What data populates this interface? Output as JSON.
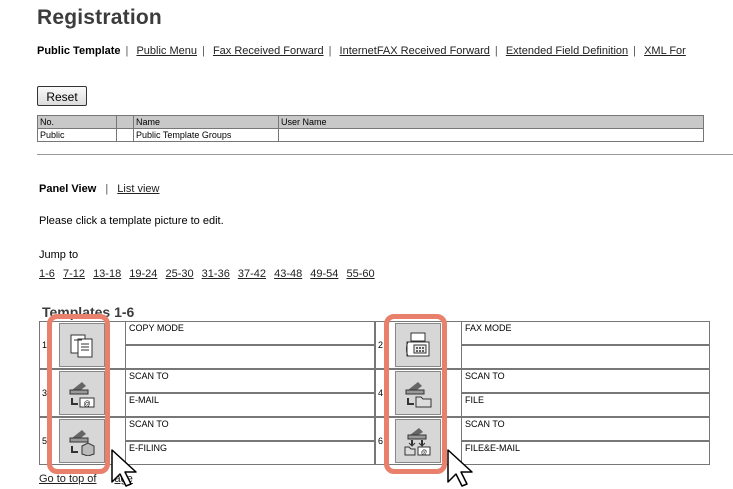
{
  "page_title": "Registration",
  "tabs": [
    {
      "label": "Public Template",
      "active": true
    },
    {
      "label": "Public Menu"
    },
    {
      "label": "Fax Received Forward"
    },
    {
      "label": "InternetFAX Received Forward"
    },
    {
      "label": "Extended Field Definition"
    },
    {
      "label": "XML For"
    }
  ],
  "reset_label": "Reset",
  "info_table": {
    "headers": [
      "No.",
      "",
      "Name",
      "User Name"
    ],
    "row": [
      "Public",
      "",
      "Public Template Groups",
      ""
    ]
  },
  "view": {
    "panel": "Panel View",
    "list": "List view"
  },
  "instruction": "Please click a template picture to edit.",
  "jump_to": "Jump to",
  "jump_links": [
    "1-6",
    "7-12",
    "13-18",
    "19-24",
    "25-30",
    "31-36",
    "37-42",
    "43-48",
    "49-54",
    "55-60"
  ],
  "templates_heading": "Templates 1-6",
  "templates": [
    {
      "num": "1",
      "line1": "COPY MODE",
      "line2": "",
      "icon": "copy-icon"
    },
    {
      "num": "2",
      "line1": "FAX MODE",
      "line2": "",
      "icon": "fax-icon"
    },
    {
      "num": "3",
      "line1": "SCAN TO",
      "line2": "E-MAIL",
      "icon": "scan-email-icon"
    },
    {
      "num": "4",
      "line1": "SCAN TO",
      "line2": "FILE",
      "icon": "scan-file-icon"
    },
    {
      "num": "5",
      "line1": "SCAN TO",
      "line2": "E-FILING",
      "icon": "scan-efiling-icon"
    },
    {
      "num": "6",
      "line1": "SCAN TO",
      "line2": "FILE&E-MAIL",
      "icon": "scan-file-email-icon"
    }
  ],
  "goto_top_visible": "Go to top of",
  "goto_top_tail": "age",
  "highlight_color": "#e9806c"
}
